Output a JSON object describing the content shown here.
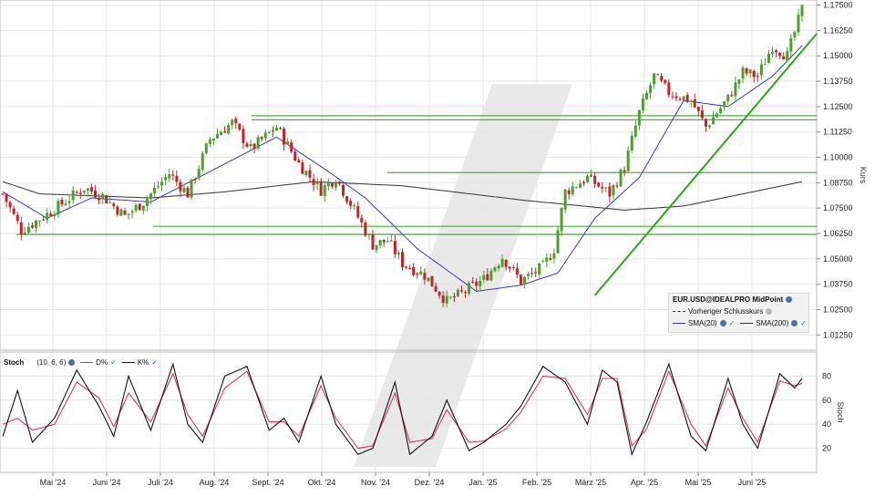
{
  "colors": {
    "up": "#4aa02c",
    "down": "#c0242b",
    "sma20": "#3a3aa8",
    "sma200": "#333333",
    "support": "#4fae3f",
    "trend": "#2ea51a",
    "d_line": "#d23b5a",
    "k_line": "#111111"
  },
  "chart_data": [
    {
      "type": "candlestick",
      "title": "EUR.USD@IDEALPRO MidPoint",
      "ylabel": "Kurs",
      "ylim": [
        1.005,
        1.1775
      ],
      "yticks": [
        "1.17500",
        "1.16250",
        "1.15000",
        "1.13750",
        "1.12500",
        "1.11250",
        "1.10000",
        "1.08750",
        "1.07500",
        "1.06250",
        "1.05000",
        "1.03750",
        "1.02500",
        "1.01250"
      ],
      "xticks": [
        "Mai '24",
        "Juni '24",
        "Juli '24",
        "Aug. '24",
        "Sept. '24",
        "Okt. '24",
        "Nov. '24",
        "Dez. '24",
        "Jan. '25",
        "Feb. '25",
        "März '25",
        "Apr. '25",
        "Mai '25",
        "Juni '25"
      ],
      "legend": [
        "EUR.USD@IDEALPRO MidPoint",
        "Vorheriger Schlusskurs",
        "SMA(20)",
        "SMA(200)"
      ],
      "series": [
        {
          "name": "EUR.USD@IDEALPRO MidPoint",
          "kind": "candles",
          "anchors": [
            [
              0,
              1.082
            ],
            [
              5,
              1.064
            ],
            [
              12,
              1.072
            ],
            [
              22,
              1.085
            ],
            [
              27,
              1.081
            ],
            [
              33,
              1.071
            ],
            [
              38,
              1.078
            ],
            [
              45,
              1.092
            ],
            [
              50,
              1.082
            ],
            [
              56,
              1.109
            ],
            [
              62,
              1.117
            ],
            [
              67,
              1.104
            ],
            [
              74,
              1.115
            ],
            [
              80,
              1.097
            ],
            [
              86,
              1.084
            ],
            [
              90,
              1.09
            ],
            [
              95,
              1.074
            ],
            [
              100,
              1.057
            ],
            [
              104,
              1.059
            ],
            [
              108,
              1.048
            ],
            [
              114,
              1.042
            ],
            [
              120,
              1.029
            ],
            [
              124,
              1.033
            ],
            [
              130,
              1.04
            ],
            [
              135,
              1.051
            ],
            [
              140,
              1.039
            ],
            [
              146,
              1.046
            ],
            [
              149,
              1.055
            ],
            [
              152,
              1.083
            ],
            [
              158,
              1.09
            ],
            [
              164,
              1.082
            ],
            [
              168,
              1.095
            ],
            [
              172,
              1.122
            ],
            [
              176,
              1.14
            ],
            [
              180,
              1.132
            ],
            [
              186,
              1.128
            ],
            [
              190,
              1.115
            ],
            [
              196,
              1.129
            ],
            [
              200,
              1.142
            ],
            [
              204,
              1.14
            ],
            [
              208,
              1.155
            ],
            [
              212,
              1.15
            ],
            [
              216,
              1.173
            ]
          ],
          "count": 217
        },
        {
          "name": "SMA(20)",
          "kind": "line",
          "values": [
            [
              0,
              1.083
            ],
            [
              12,
              1.07
            ],
            [
              24,
              1.08
            ],
            [
              40,
              1.078
            ],
            [
              56,
              1.093
            ],
            [
              74,
              1.11
            ],
            [
              88,
              1.093
            ],
            [
              98,
              1.08
            ],
            [
              112,
              1.055
            ],
            [
              128,
              1.034
            ],
            [
              140,
              1.037
            ],
            [
              150,
              1.043
            ],
            [
              160,
              1.07
            ],
            [
              172,
              1.09
            ],
            [
              184,
              1.128
            ],
            [
              196,
              1.125
            ],
            [
              208,
              1.14
            ],
            [
              216,
              1.155
            ]
          ]
        },
        {
          "name": "SMA(200)",
          "kind": "line",
          "values": [
            [
              0,
              1.088
            ],
            [
              10,
              1.082
            ],
            [
              40,
              1.08
            ],
            [
              60,
              1.083
            ],
            [
              84,
              1.088
            ],
            [
              108,
              1.086
            ],
            [
              140,
              1.079
            ],
            [
              168,
              1.074
            ],
            [
              184,
              1.076
            ],
            [
              216,
              1.088
            ]
          ]
        }
      ],
      "support_levels": [
        1.1205,
        1.1185,
        1.0925,
        1.066,
        1.062
      ],
      "trendline": [
        [
          160,
          1.032
        ],
        [
          220,
          1.161
        ]
      ]
    },
    {
      "type": "line",
      "title": "Stoch",
      "params": "(10, 6, 6)",
      "ylabel": "Stoch",
      "ylim": [
        0,
        100
      ],
      "yticks": [
        80,
        60,
        40,
        20
      ],
      "series": [
        {
          "name": "K%",
          "values": [
            [
              0,
              30
            ],
            [
              4,
              68
            ],
            [
              8,
              25
            ],
            [
              14,
              45
            ],
            [
              20,
              85
            ],
            [
              26,
              55
            ],
            [
              30,
              30
            ],
            [
              34,
              80
            ],
            [
              40,
              35
            ],
            [
              46,
              90
            ],
            [
              50,
              40
            ],
            [
              54,
              25
            ],
            [
              60,
              80
            ],
            [
              66,
              88
            ],
            [
              72,
              35
            ],
            [
              76,
              45
            ],
            [
              80,
              25
            ],
            [
              86,
              80
            ],
            [
              90,
              40
            ],
            [
              96,
              15
            ],
            [
              100,
              20
            ],
            [
              106,
              75
            ],
            [
              110,
              15
            ],
            [
              116,
              30
            ],
            [
              120,
              60
            ],
            [
              126,
              18
            ],
            [
              130,
              25
            ],
            [
              136,
              40
            ],
            [
              140,
              55
            ],
            [
              146,
              88
            ],
            [
              152,
              75
            ],
            [
              158,
              40
            ],
            [
              162,
              85
            ],
            [
              166,
              75
            ],
            [
              170,
              15
            ],
            [
              174,
              42
            ],
            [
              180,
              90
            ],
            [
              186,
              30
            ],
            [
              190,
              18
            ],
            [
              196,
              78
            ],
            [
              200,
              40
            ],
            [
              204,
              20
            ],
            [
              210,
              82
            ],
            [
              214,
              70
            ],
            [
              216,
              78
            ]
          ]
        },
        {
          "name": "D%",
          "values": [
            [
              0,
              40
            ],
            [
              4,
              45
            ],
            [
              8,
              35
            ],
            [
              14,
              40
            ],
            [
              20,
              75
            ],
            [
              26,
              62
            ],
            [
              30,
              38
            ],
            [
              34,
              66
            ],
            [
              40,
              42
            ],
            [
              46,
              82
            ],
            [
              50,
              48
            ],
            [
              54,
              30
            ],
            [
              60,
              70
            ],
            [
              66,
              84
            ],
            [
              72,
              42
            ],
            [
              76,
              42
            ],
            [
              80,
              30
            ],
            [
              86,
              72
            ],
            [
              90,
              45
            ],
            [
              96,
              20
            ],
            [
              100,
              22
            ],
            [
              106,
              66
            ],
            [
              110,
              25
            ],
            [
              116,
              28
            ],
            [
              120,
              52
            ],
            [
              126,
              25
            ],
            [
              130,
              26
            ],
            [
              136,
              36
            ],
            [
              140,
              50
            ],
            [
              146,
              80
            ],
            [
              152,
              78
            ],
            [
              158,
              48
            ],
            [
              162,
              78
            ],
            [
              166,
              78
            ],
            [
              170,
              22
            ],
            [
              174,
              36
            ],
            [
              180,
              84
            ],
            [
              186,
              40
            ],
            [
              190,
              22
            ],
            [
              196,
              70
            ],
            [
              200,
              45
            ],
            [
              204,
              25
            ],
            [
              210,
              76
            ],
            [
              214,
              72
            ],
            [
              216,
              74
            ]
          ]
        }
      ]
    }
  ],
  "main_legend": {
    "title": "EUR.USD@IDEALPRO MidPoint",
    "prev_close": "Vorheriger Schlusskurs",
    "sma20": "SMA(20)",
    "sma200": "SMA(200)"
  },
  "stoch_legend": {
    "name": "Stoch",
    "params": "(10, 6, 6)",
    "d": "D%",
    "k": "K%"
  }
}
